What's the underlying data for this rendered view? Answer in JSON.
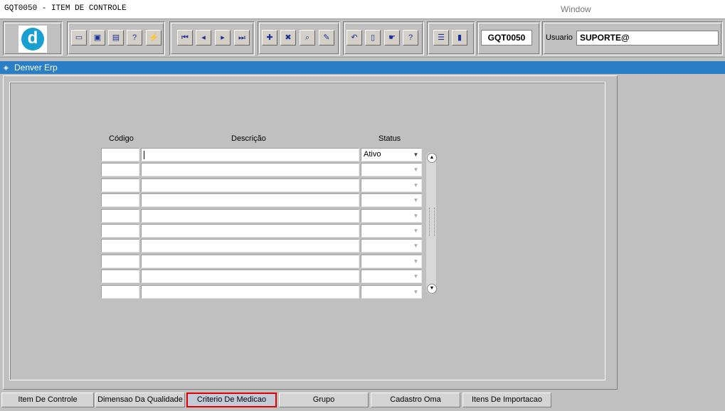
{
  "menubar": {
    "app_title": "GQT0050 - ITEM DE CONTROLE",
    "window_menu": "Window"
  },
  "toolbar": {
    "buttons": [
      {
        "name": "save-icon",
        "glyph": "▭"
      },
      {
        "name": "window-icon",
        "glyph": "▣"
      },
      {
        "name": "print-icon",
        "glyph": "▤"
      },
      {
        "name": "help-query-icon",
        "glyph": "?"
      },
      {
        "name": "execute-icon",
        "glyph": "⚡"
      },
      {
        "name": "first-record-icon",
        "glyph": "⏮"
      },
      {
        "name": "previous-record-icon",
        "glyph": "◂"
      },
      {
        "name": "next-record-icon",
        "glyph": "▸"
      },
      {
        "name": "last-record-icon",
        "glyph": "⏭"
      },
      {
        "name": "insert-record-icon",
        "glyph": "✚"
      },
      {
        "name": "delete-record-icon",
        "glyph": "✖"
      },
      {
        "name": "enter-query-icon",
        "glyph": "⌕"
      },
      {
        "name": "edit-icon",
        "glyph": "✎"
      },
      {
        "name": "undo-icon",
        "glyph": "↶"
      },
      {
        "name": "clipboard-icon",
        "glyph": "▯"
      },
      {
        "name": "tools-icon",
        "glyph": "☛"
      },
      {
        "name": "help-icon",
        "glyph": "?"
      },
      {
        "name": "menu-icon",
        "glyph": "☰"
      },
      {
        "name": "exit-icon",
        "glyph": "▮"
      }
    ],
    "form_code": "GQT0050",
    "user_label": "Usuario",
    "user_value": "SUPORTE@"
  },
  "window": {
    "title": "Denver Erp"
  },
  "grid": {
    "headers": {
      "code": "Código",
      "description": "Descrição",
      "status": "Status"
    },
    "rows": [
      {
        "code": "",
        "description": "",
        "status": "Ativo"
      },
      {
        "code": "",
        "description": "",
        "status": ""
      },
      {
        "code": "",
        "description": "",
        "status": ""
      },
      {
        "code": "",
        "description": "",
        "status": ""
      },
      {
        "code": "",
        "description": "",
        "status": ""
      },
      {
        "code": "",
        "description": "",
        "status": ""
      },
      {
        "code": "",
        "description": "",
        "status": ""
      },
      {
        "code": "",
        "description": "",
        "status": ""
      },
      {
        "code": "",
        "description": "",
        "status": ""
      },
      {
        "code": "",
        "description": "",
        "status": ""
      }
    ]
  },
  "tabs": [
    {
      "label": "Item De Controle",
      "active": false
    },
    {
      "label": "Dimensao Da Qualidade",
      "active": false
    },
    {
      "label": "Criterio De Medicao",
      "active": true
    },
    {
      "label": "Grupo",
      "active": false
    },
    {
      "label": "Cadastro Oma",
      "active": false
    },
    {
      "label": "Itens De Importacao",
      "active": false
    }
  ]
}
